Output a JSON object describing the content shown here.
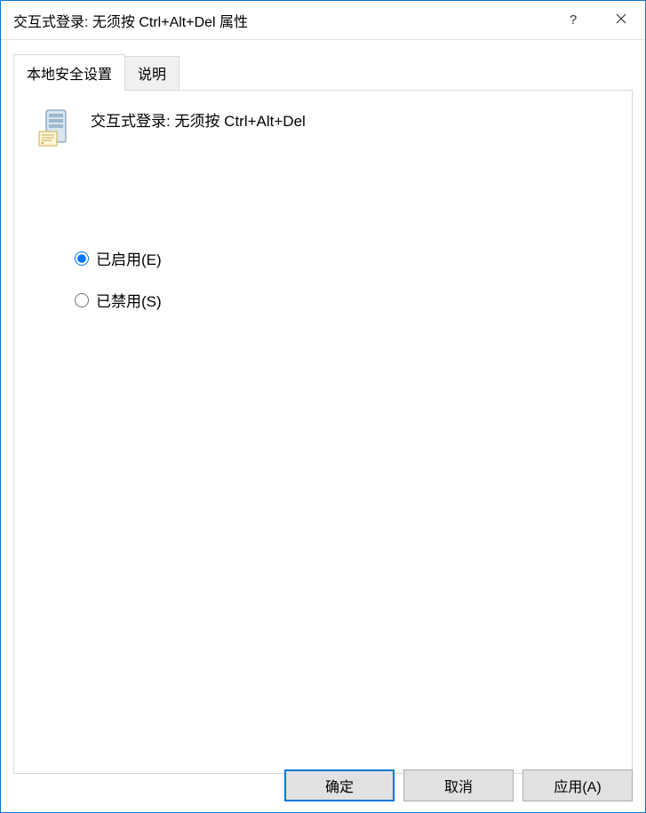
{
  "window": {
    "title": "交互式登录: 无须按 Ctrl+Alt+Del 属性"
  },
  "tabs": {
    "local_security": "本地安全设置",
    "explain": "说明"
  },
  "policy": {
    "title": "交互式登录: 无须按 Ctrl+Alt+Del"
  },
  "options": {
    "enabled": "已启用(E)",
    "disabled": "已禁用(S)"
  },
  "buttons": {
    "ok": "确定",
    "cancel": "取消",
    "apply": "应用(A)"
  }
}
